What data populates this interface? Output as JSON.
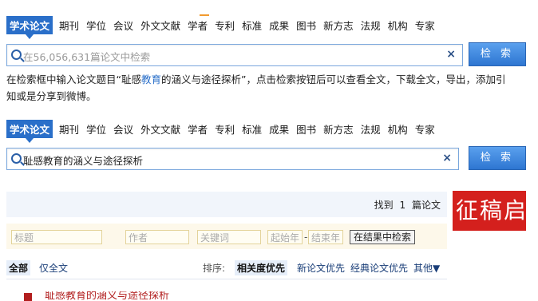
{
  "categories": [
    "学术论文",
    "期刊",
    "学位",
    "会议",
    "外文文献",
    "学者",
    "专利",
    "标准",
    "成果",
    "图书",
    "新方志",
    "法规",
    "机构",
    "专家"
  ],
  "search_top": {
    "placeholder": "在56,056,631篇论文中检索",
    "button": "检 索",
    "clear": "×"
  },
  "instruction": {
    "part1": "在检索框中输入论文题目“耻感",
    "highlight": "教育",
    "part2": "的涵义与途径探析”，点击检索按钮后可以查看全文，下载全文，导出，添加引",
    "line2": "知或是分享到微博。"
  },
  "search_bottom": {
    "value": "耻感教育的涵义与途径探析",
    "button": "检 索",
    "clear": "×"
  },
  "results_summary": {
    "prefix": "找到",
    "count": "1",
    "suffix": "篇论文"
  },
  "filters": {
    "title": "标题",
    "author": "作者",
    "keyword": "关键词",
    "start_year": "起始年",
    "dash": "-",
    "end_year": "结束年",
    "button": "在结果中检索"
  },
  "sort": {
    "all": "全部",
    "fulltext_only": "仅全文",
    "label": "排序:",
    "relevance": "相关度优先",
    "newest": "新论文优先",
    "classic": "经典论文优先",
    "other": "其他▼"
  },
  "banner_text": "征稿启",
  "first_result": "耻感教育的涵义与途径探析",
  "colors": {
    "accent": "#2a6fc9",
    "banner": "#d4201d",
    "result_link": "#b21e1e"
  }
}
